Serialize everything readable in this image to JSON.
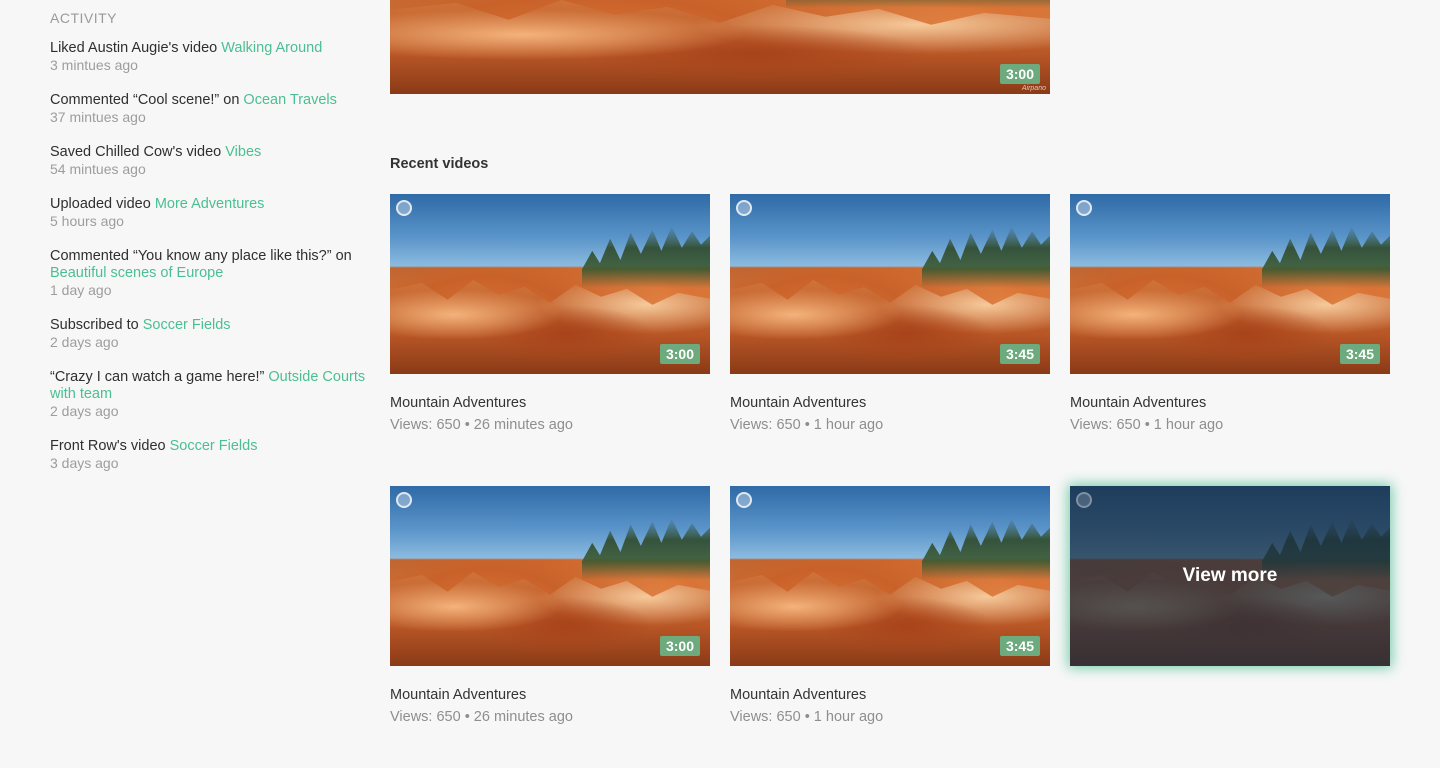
{
  "activity": {
    "heading": "ACTIVITY",
    "items": [
      {
        "text": "Liked Austin Augie's video ",
        "link": "Walking Around",
        "time": "3 mintues ago"
      },
      {
        "text": "Commented “Cool scene!” on ",
        "link": "Ocean Travels",
        "time": "37 mintues ago"
      },
      {
        "text": "Saved Chilled Cow's video ",
        "link": "Vibes",
        "time": "54 mintues ago"
      },
      {
        "text": "Uploaded video ",
        "link": "More Adventures",
        "time": "5 hours ago"
      },
      {
        "text": "Commented “You know any place like this?” on ",
        "link": "Beautiful scenes of Europe",
        "time": "1 day ago"
      },
      {
        "text": "Subscribed to ",
        "link": "Soccer Fields",
        "time": "2 days ago"
      },
      {
        "text": "“Crazy I can watch a game here!” ",
        "link": "Outside Courts with team",
        "time": "2 days ago"
      },
      {
        "text": "Front Row's video ",
        "link": "Soccer Fields",
        "time": "3 days ago"
      }
    ]
  },
  "featured": {
    "duration": "3:00",
    "watermark": "Airpano"
  },
  "recent": {
    "title": "Recent videos",
    "videos": [
      {
        "title": "Mountain Adventures",
        "meta": "Views: 650 • 26 minutes ago",
        "duration": "3:00"
      },
      {
        "title": "Mountain Adventures",
        "meta": "Views: 650 • 1 hour ago",
        "duration": "3:45"
      },
      {
        "title": "Mountain Adventures",
        "meta": "Views: 650 • 1 hour ago",
        "duration": "3:45"
      },
      {
        "title": "Mountain Adventures",
        "meta": "Views: 650 • 26 minutes ago",
        "duration": "3:00"
      },
      {
        "title": "Mountain Adventures",
        "meta": "Views: 650 • 1 hour ago",
        "duration": "3:45"
      }
    ],
    "view_more_label": "View more"
  },
  "colors": {
    "accent": "#4bbf93",
    "duration_badge": "#6daa7e",
    "overlay": "#182c40"
  },
  "icons": {
    "select": "select-circle-icon"
  }
}
